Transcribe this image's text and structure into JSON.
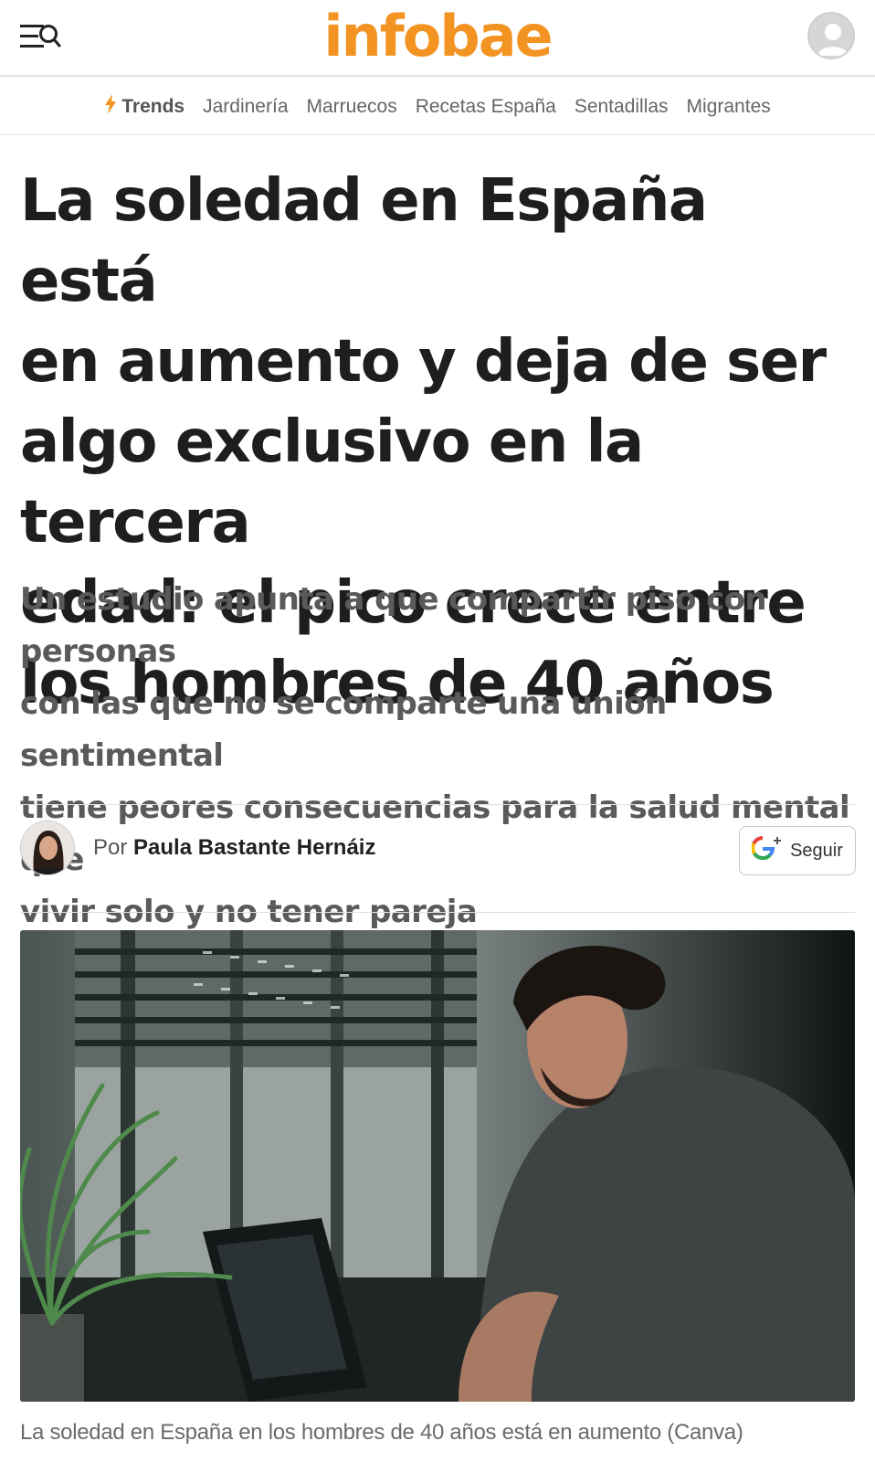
{
  "header": {
    "logo_text": "infobae",
    "menu_icon": "menu-search-icon",
    "account_icon": "user-icon",
    "logo_color": "#f39322"
  },
  "trends": {
    "label": "Trends",
    "icon": "lightning-icon",
    "items": [
      "Jardinería",
      "Marruecos",
      "Recetas España",
      "Sentadillas",
      "Migrantes"
    ]
  },
  "article": {
    "headline_lines": [
      "La soledad en España está",
      "en aumento y deja de ser",
      "algo exclusivo en la tercera",
      "edad: el pico crece entre",
      "los hombres de 40 años"
    ],
    "subtitle_lines": [
      "Un estudio apunta a que compartir piso con personas",
      "con las que no se comparte una unión sentimental",
      "tiene peores consecuencias para la salud mental que",
      "vivir solo y no tener pareja"
    ],
    "byline_prefix": "Por",
    "author": "Paula Bastante Hernáiz",
    "follow_label": "Seguir",
    "follow_icon": "google-plus-icon",
    "image_caption": "La soledad en España en los hombres de 40 años está en aumento (Canva)"
  }
}
